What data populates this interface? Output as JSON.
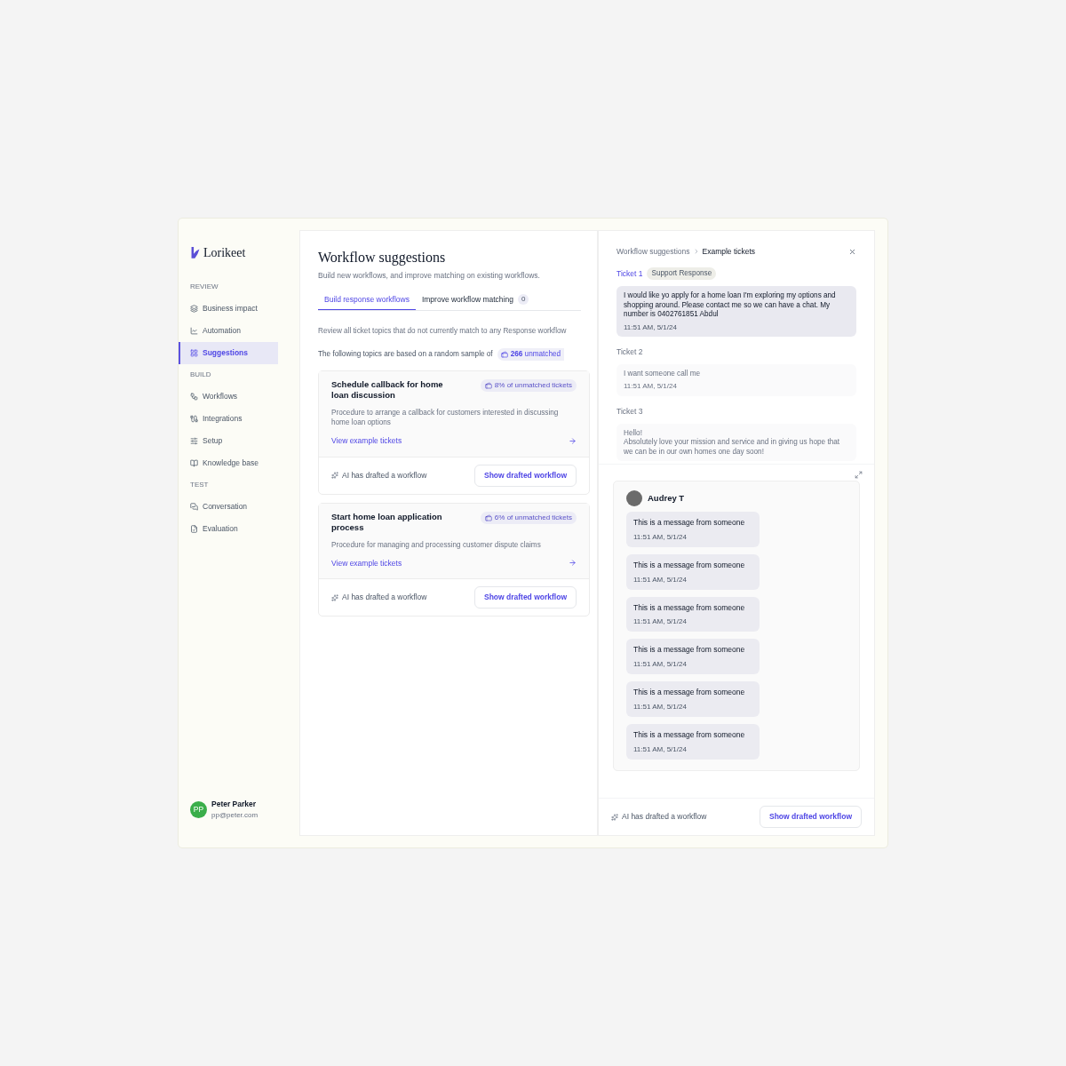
{
  "brand": {
    "name": "Lorikeet"
  },
  "sidebar": {
    "sections": [
      {
        "title": "REVIEW",
        "items": [
          {
            "label": "Business impact",
            "selected": false
          },
          {
            "label": "Automation",
            "selected": false
          },
          {
            "label": "Suggestions",
            "selected": true
          }
        ]
      },
      {
        "title": "BUILD",
        "items": [
          {
            "label": "Workflows",
            "selected": false
          },
          {
            "label": "Integrations",
            "selected": false
          },
          {
            "label": "Setup",
            "selected": false
          },
          {
            "label": "Knowledge base",
            "selected": false
          }
        ]
      },
      {
        "title": "TEST",
        "items": [
          {
            "label": "Conversation",
            "selected": false
          },
          {
            "label": "Evaluation",
            "selected": false
          }
        ]
      }
    ]
  },
  "user": {
    "initials": "PP",
    "name": "Peter Parker",
    "email": "pp@peter.com"
  },
  "main": {
    "title": "Workflow suggestions",
    "subtitle": "Build new workflows, and improve matching on existing workflows.",
    "tabs": [
      {
        "label": "Build response workflows",
        "selected": true
      },
      {
        "label": "Improve workflow matching",
        "count": "0",
        "selected": false
      }
    ],
    "intro": "Review all ticket topics that do not currently match to any Response workflow",
    "sample_text": "The following topics are based on a random sample of",
    "sample_badge": "**266** unmatched",
    "cards": [
      {
        "title": "Schedule callback for home loan discussion",
        "badge": "8% of unmatched tickets",
        "description": "Procedure to arrange a callback for customers interested in discussing home loan options",
        "link": "View example tickets",
        "note": "AI has drafted a workflow",
        "button": "Show drafted workflow"
      },
      {
        "title": "Start home loan application process",
        "badge": "6% of unmatched tickets",
        "description": "Procedure for managing and processing customer dispute claims",
        "link": "View example tickets",
        "note": "AI has drafted a workflow",
        "button": "Show drafted workflow"
      }
    ]
  },
  "panel": {
    "breadcrumb": [
      "Workflow suggestions",
      "Example tickets"
    ],
    "tickets": [
      {
        "label": "Ticket 1",
        "tag": "Support Response",
        "selected": true,
        "lines": [
          "I would like yo apply for a home loan I'm exploring my options and shopping around. Please contact me so we can have a chat. My number is 0402761851 Abdul"
        ],
        "time": "11:51 AM, 5/1/24"
      },
      {
        "label": "Ticket 2",
        "selected": false,
        "lines": [
          "I want someone call me"
        ],
        "time": "11:51 AM, 5/1/24"
      },
      {
        "label": "Ticket 3",
        "selected": false,
        "lines": [
          "Hello!",
          "Absolutely love your mission and service and in giving us hope that we can be in our own homes one day soon!"
        ]
      }
    ],
    "chat": {
      "name": "Audrey T",
      "messages": [
        {
          "text": "This is a message from someone",
          "time": "11:51 AM, 5/1/24"
        },
        {
          "text": "This is a message from someone",
          "time": "11:51 AM, 5/1/24"
        },
        {
          "text": "This is a message from someone",
          "time": "11:51 AM, 5/1/24"
        },
        {
          "text": "This is a message from someone",
          "time": "11:51 AM, 5/1/24"
        },
        {
          "text": "This is a message from someone",
          "time": "11:51 AM, 5/1/24"
        },
        {
          "text": "This is a message from someone",
          "time": "11:51 AM, 5/1/24"
        }
      ]
    },
    "footer": {
      "note": "AI has drafted a workflow",
      "button": "Show drafted workflow"
    }
  }
}
